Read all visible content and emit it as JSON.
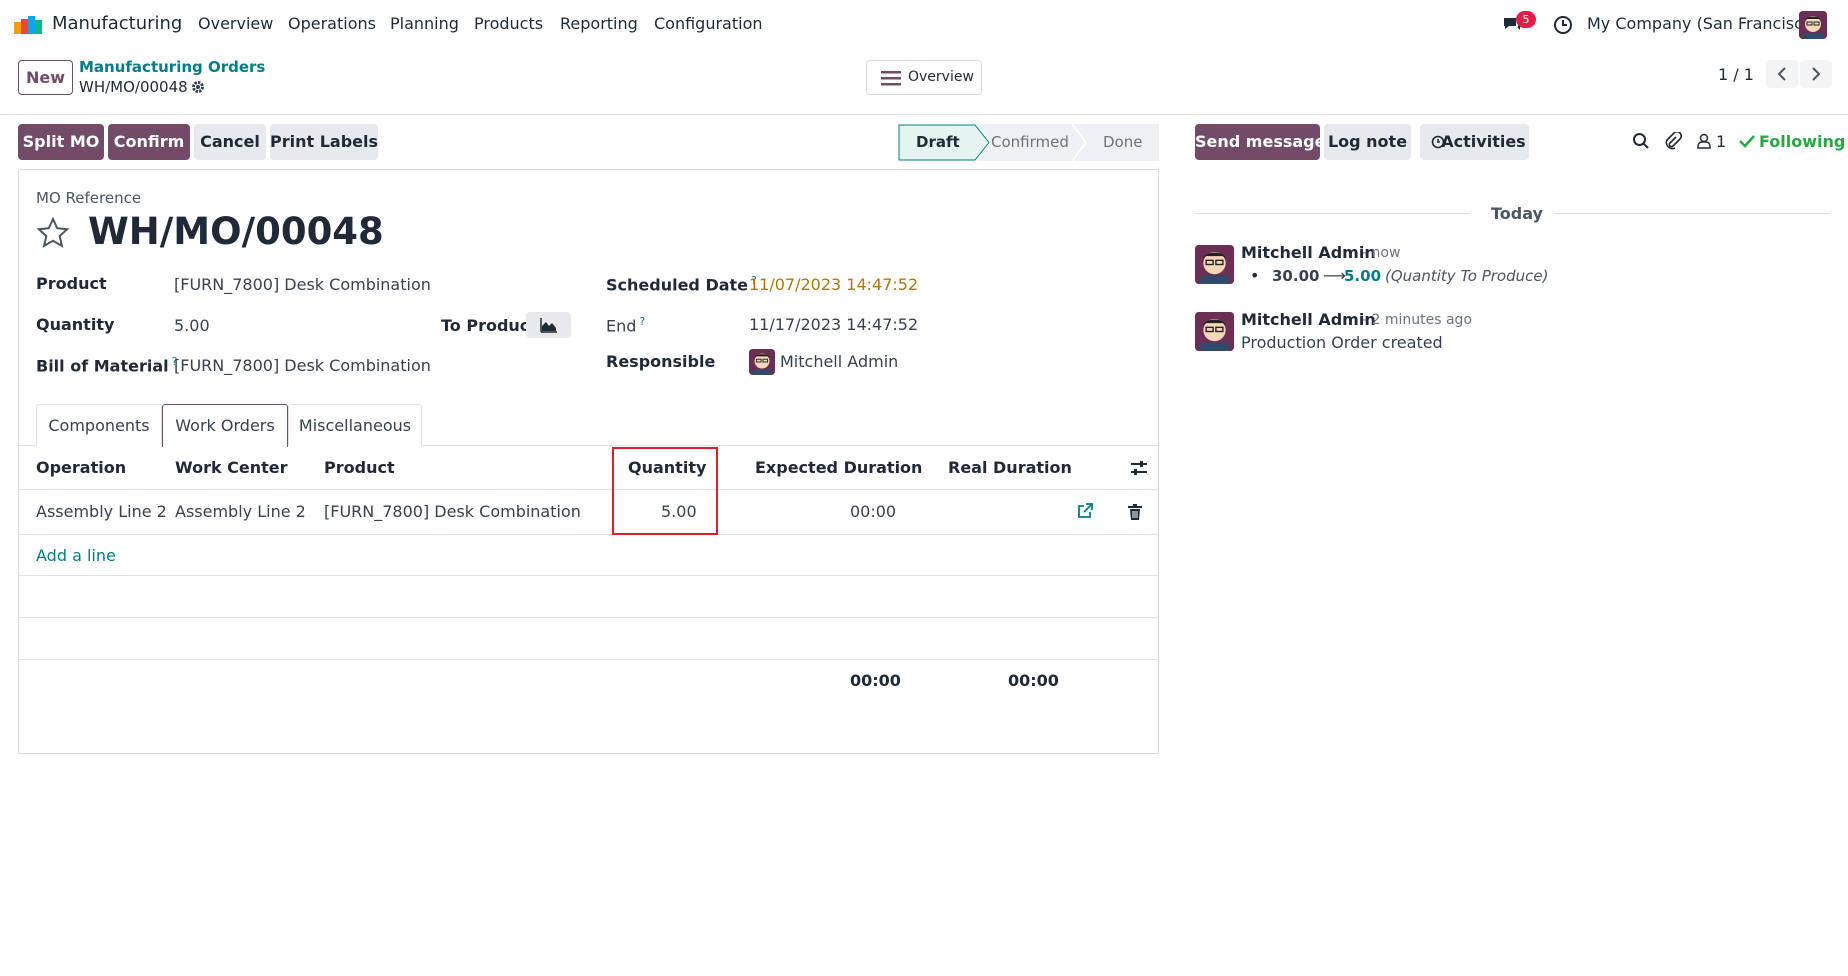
{
  "navbar": {
    "app_name": "Manufacturing",
    "menu": [
      "Overview",
      "Operations",
      "Planning",
      "Products",
      "Reporting",
      "Configuration"
    ],
    "messages_count": "5",
    "company": "My Company (San Francisco)"
  },
  "breadcrumb": {
    "new_label": "New",
    "parent": "Manufacturing Orders",
    "current": "WH/MO/00048",
    "overview_label": "Overview",
    "pager": "1 / 1"
  },
  "actions": {
    "split": "Split MO",
    "confirm": "Confirm",
    "cancel": "Cancel",
    "print": "Print Labels"
  },
  "statusbar": [
    "Draft",
    "Confirmed",
    "Done"
  ],
  "form": {
    "ref_label": "MO Reference",
    "ref": "WH/MO/00048",
    "product_label": "Product",
    "product": "[FURN_7800] Desk Combination",
    "quantity_label": "Quantity",
    "quantity": "5.00",
    "to_produce_label": "To Produce",
    "bom_label": "Bill of Material",
    "bom": "[FURN_7800] Desk Combination",
    "scheduled_label": "Scheduled Date",
    "scheduled": "11/07/2023 14:47:52",
    "end_label": "End",
    "end": "11/17/2023 14:47:52",
    "responsible_label": "Responsible",
    "responsible": "Mitchell Admin",
    "help_mark": "?"
  },
  "tabs": [
    "Components",
    "Work Orders",
    "Miscellaneous"
  ],
  "table": {
    "headers": [
      "Operation",
      "Work Center",
      "Product",
      "Quantity",
      "Expected Duration",
      "Real Duration"
    ],
    "rows": [
      {
        "operation": "Assembly Line 2",
        "work_center": "Assembly Line 2",
        "product": "[FURN_7800] Desk Combination",
        "quantity": "5.00",
        "expected": "00:00",
        "real": ""
      }
    ],
    "add_line": "Add a line",
    "total_expected": "00:00",
    "total_real": "00:00"
  },
  "chatter": {
    "send_message": "Send message",
    "log_note": "Log note",
    "activities": "Activities",
    "followers_count": "1",
    "following": "Following",
    "date_separator": "Today",
    "messages": [
      {
        "author": "Mitchell Admin",
        "time": "- now",
        "old_value": "30.00",
        "arrow": "⟶",
        "new_value": "5.00",
        "field": "(Quantity To Produce)"
      },
      {
        "author": "Mitchell Admin",
        "time": "- 2 minutes ago",
        "body": "Production Order created"
      }
    ]
  },
  "colors": {
    "brand": "#714b67",
    "link": "#017e84",
    "warning_date": "#b0760a",
    "highlight": "#e11d2a"
  }
}
